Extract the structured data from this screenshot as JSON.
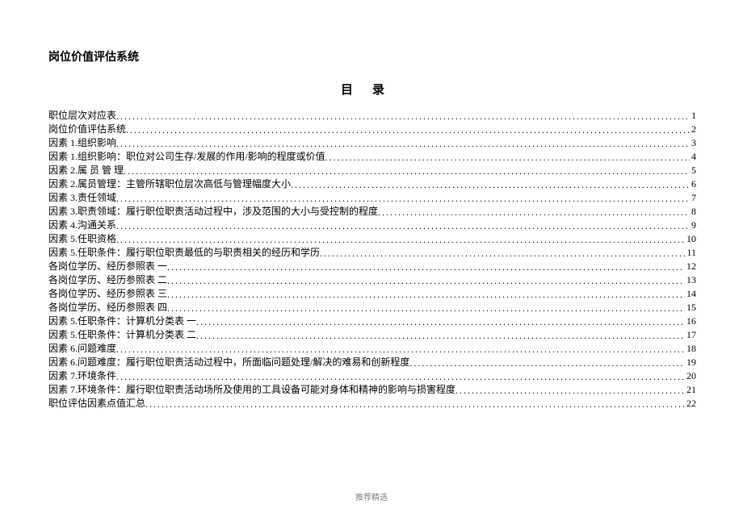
{
  "doc": {
    "title": "岗位价值评估系统",
    "toc_heading": "目录",
    "footer": "推荐精选"
  },
  "toc": [
    {
      "label": "职位层次对应表",
      "page": "1"
    },
    {
      "label": "岗位价值评估系统",
      "page": "2"
    },
    {
      "label": "因素 1.组织影响",
      "page": "3"
    },
    {
      "label": "因素 1.组织影响：职位对公司生存/发展的作用/影响的程度或价值",
      "page": "4"
    },
    {
      "label": "因素 2.属 员 管 理",
      "page": "5"
    },
    {
      "label": "因素 2.属员管理：主管所辖职位层次高低与管理幅度大小",
      "page": "6"
    },
    {
      "label": "因素 3.责任领域",
      "page": "7"
    },
    {
      "label": "因素 3.职责领域：履行职位职责活动过程中，涉及范围的大小与受控制的程度",
      "page": "8"
    },
    {
      "label": "因素 4.沟通关系",
      "page": "9"
    },
    {
      "label": "因素 5.任职资格",
      "page": "10"
    },
    {
      "label": "因素 5.任职条件：履行职位职责最低的与职责相关的经历和学历",
      "page": "11"
    },
    {
      "label": "各岗位学历、经历参照表 一",
      "page": "12"
    },
    {
      "label": "各岗位学历、经历参照表 二",
      "page": "13"
    },
    {
      "label": "各岗位学历、经历参照表 三",
      "page": "14"
    },
    {
      "label": "各岗位学历、经历参照表 四",
      "page": "15"
    },
    {
      "label": "因素 5.任职条件：计算机分类表 一",
      "page": "16"
    },
    {
      "label": "因素 5.任职条件：计算机分类表 二",
      "page": "17"
    },
    {
      "label": "因素 6.问题难度",
      "page": "18"
    },
    {
      "label": "因素 6.问题难度：履行职位职责活动过程中，所面临问题处理/解决的难易和创新程度",
      "page": "19"
    },
    {
      "label": "因素 7.环境条件",
      "page": "20"
    },
    {
      "label": "因素 7.环境条件：履行职位职责活动场所及使用的工具设备可能对身体和精神的影响与损害程度",
      "page": "21"
    },
    {
      "label": "职位评估因素点值汇总",
      "page": "22"
    }
  ]
}
